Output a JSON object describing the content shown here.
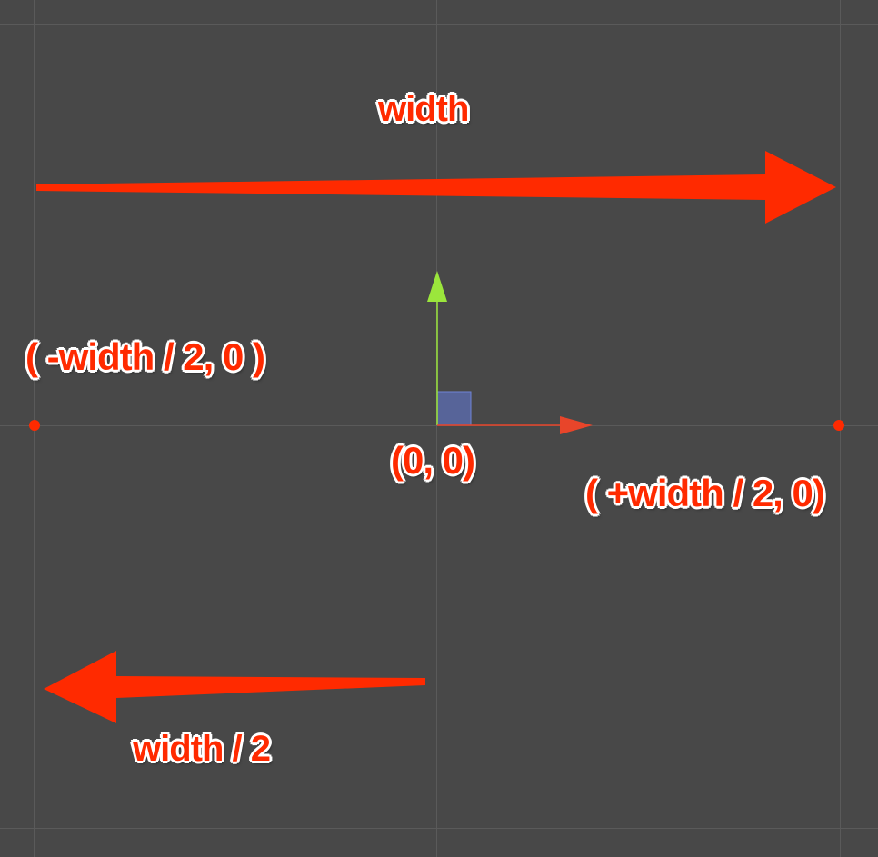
{
  "labels": {
    "width": "width",
    "neg_half": "( -width / 2, 0 )",
    "origin": "(0, 0)",
    "pos_half": "( +width / 2, 0)",
    "width_half": "width / 2"
  },
  "colors": {
    "background": "#484848",
    "grid_line": "#5a5a5a",
    "annotation_red": "#ff2a00",
    "y_axis_gizmo": "#9be63c",
    "x_axis_gizmo": "#e8452a",
    "origin_square": "#5a6aa8"
  }
}
